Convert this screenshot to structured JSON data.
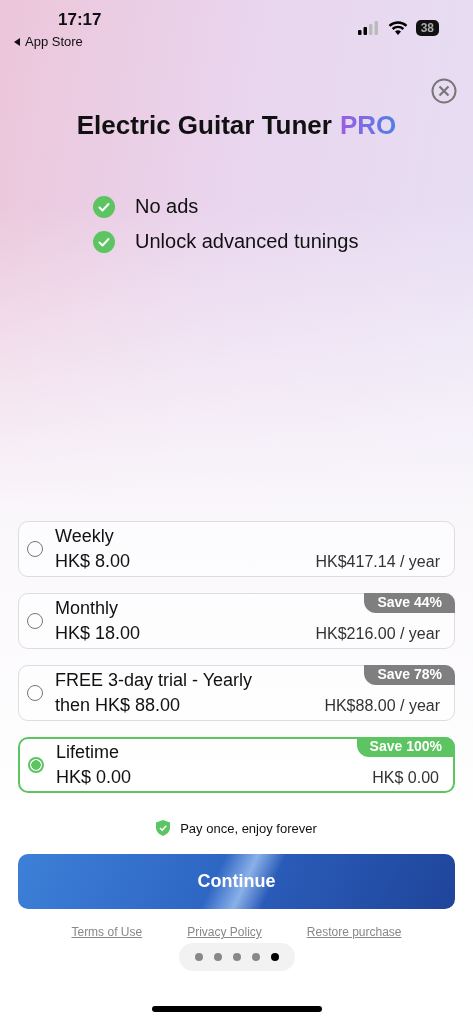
{
  "status_bar": {
    "time": "17:17",
    "back_label": "App Store",
    "battery": "38"
  },
  "title": "Electric Guitar Tuner",
  "title_badge": "PRO",
  "features": [
    "No ads",
    "Unlock advanced tunings"
  ],
  "plans": [
    {
      "name": "Weekly",
      "price": "HK$ 8.00",
      "per_year": "HK$417.14 / year",
      "selected": false
    },
    {
      "name": "Monthly",
      "price": "HK$ 18.00",
      "per_year": "HK$216.00 / year",
      "badge": "Save 44%",
      "selected": false
    },
    {
      "name": "FREE 3-day trial - Yearly",
      "price": "then HK$ 88.00",
      "per_year": "HK$88.00 / year",
      "badge": "Save 78%",
      "selected": false
    },
    {
      "name": "Lifetime",
      "price": "HK$ 0.00",
      "per_year": "HK$ 0.00",
      "badge": "Save 100%",
      "selected": true
    }
  ],
  "note": "Pay once, enjoy forever",
  "continue_button": "Continue",
  "links": [
    "Terms of Use",
    "Privacy Policy",
    "Restore purchase"
  ],
  "pages": [
    {
      "selected": false
    },
    {
      "selected": false
    },
    {
      "selected": false
    },
    {
      "selected": false
    },
    {
      "selected": true
    }
  ]
}
